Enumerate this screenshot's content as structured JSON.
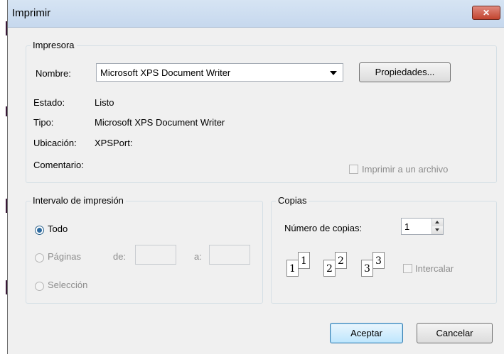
{
  "window": {
    "title": "Imprimir",
    "close_label": "✕"
  },
  "printer": {
    "legend": "Impresora",
    "name_label": "Nombre:",
    "name_value": "Microsoft XPS Document Writer",
    "properties_button": "Propiedades...",
    "status_label": "Estado:",
    "status_value": "Listo",
    "type_label": "Tipo:",
    "type_value": "Microsoft XPS Document Writer",
    "location_label": "Ubicación:",
    "location_value": "XPSPort:",
    "comment_label": "Comentario:",
    "print_to_file_label": "Imprimir a un archivo",
    "print_to_file_checked": false
  },
  "range": {
    "legend": "Intervalo de impresión",
    "all_label": "Todo",
    "pages_label": "Páginas",
    "from_label": "de:",
    "to_label": "a:",
    "selection_label": "Selección",
    "selected": "all"
  },
  "copies": {
    "legend": "Copias",
    "count_label": "Número de copias:",
    "count_value": "1",
    "collate_label": "Intercalar",
    "collate_checked": false,
    "page_stacks": [
      {
        "back": "1",
        "front": "1"
      },
      {
        "back": "2",
        "front": "2"
      },
      {
        "back": "3",
        "front": "3"
      }
    ]
  },
  "actions": {
    "ok_label": "Aceptar",
    "cancel_label": "Cancelar"
  }
}
